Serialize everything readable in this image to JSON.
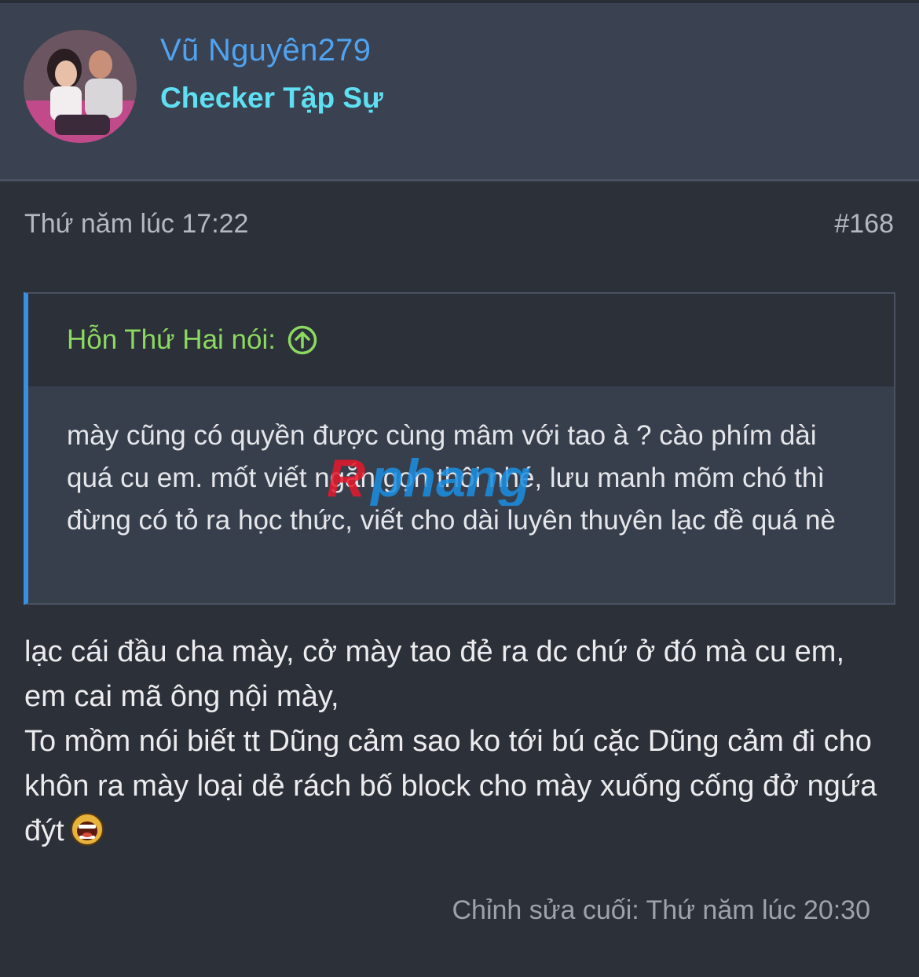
{
  "author": {
    "name": "Vũ Nguyên279",
    "title": "Checker Tập Sự"
  },
  "post": {
    "date": "Thứ năm lúc 17:22",
    "number": "#168",
    "quote": {
      "author_label": "Hỗn Thứ Hai nói:",
      "text": "mày cũng có quyền được cùng mâm với tao à ? cào phím dài quá cu em. mốt viết ngắn gọn thôi nhé, lưu manh mõm chó thì đừng có tỏ ra học thức, viết cho dài luyên thuyên lạc đề quá nè"
    },
    "body_lines": [
      "lạc cái đầu cha mày, cở mày tao đẻ ra dc chứ ở đó mà cu em, em cai mã ông nội mày,",
      "To mồm nói biết tt Dũng cảm sao ko tới bú cặc Dũng cảm đi cho khôn ra mày loại dẻ rách bố block cho mày xuống cống đở ngứa đýt"
    ],
    "last_edit": "Chỉnh sửa cuối: Thứ năm lúc 20:30"
  },
  "watermark_text": "Rphang",
  "colors": {
    "header_bg": "#3a4150",
    "page_bg": "#2c3039",
    "author_name": "#4fa3f0",
    "author_title": "#5ee0f2",
    "quote_author": "#8cd960",
    "quote_accent": "#3b8fe3"
  },
  "icons": {
    "quote_jump": "arrow-up-circle-icon",
    "emoji": "screaming-face-emoji"
  }
}
